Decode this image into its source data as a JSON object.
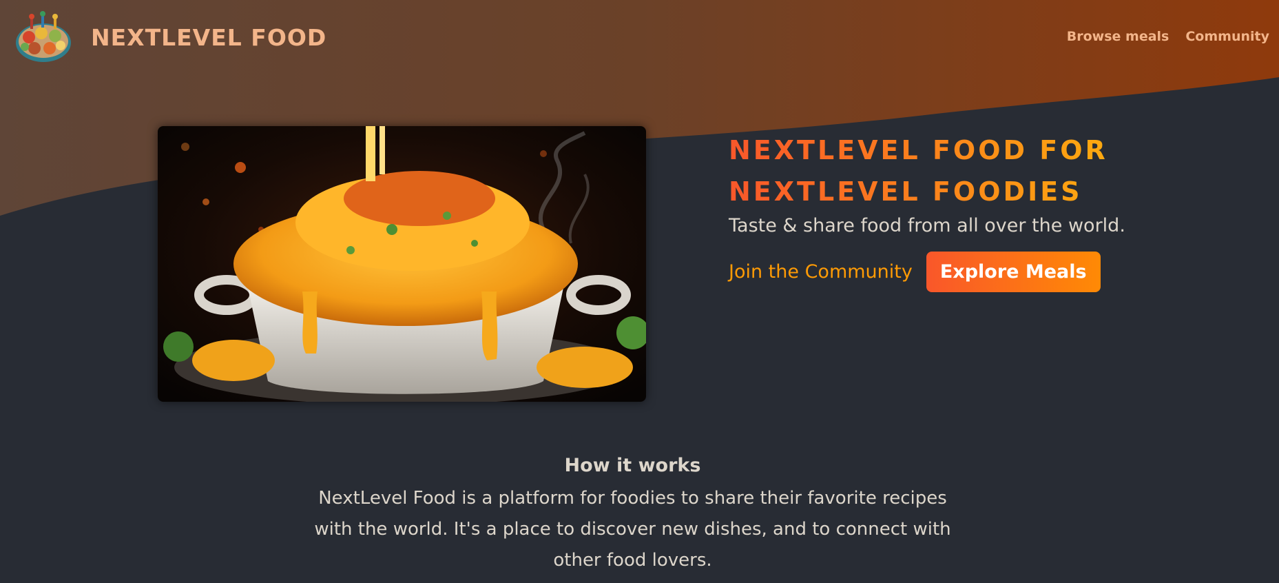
{
  "brand": {
    "name": "NEXTLEVEL FOOD",
    "logo_icon": "food-platter-icon"
  },
  "nav": {
    "items": [
      {
        "label": "Browse meals"
      },
      {
        "label": "Community"
      }
    ]
  },
  "hero": {
    "image_icon": "mac-and-cheese-photo",
    "title_line1": "NEXTLEVEL FOOD FOR",
    "title_line2": "NEXTLEVEL FOODIES",
    "subtitle": "Taste & share food from all over the world.",
    "community_link": "Join the Community",
    "explore_button": "Explore Meals"
  },
  "how_it_works": {
    "heading": "How it works",
    "body": "NextLevel Food is a platform for foodies to share their favorite recipes with the world. It's a place to discover new dishes, and to connect with other food lovers."
  },
  "colors": {
    "background": "#282c34",
    "accent_orange": "#f9572a",
    "accent_yellow": "#ffc905",
    "link_orange": "#ff9b05",
    "nav_text": "#f3b58a",
    "body_text": "#ddd6cb"
  }
}
